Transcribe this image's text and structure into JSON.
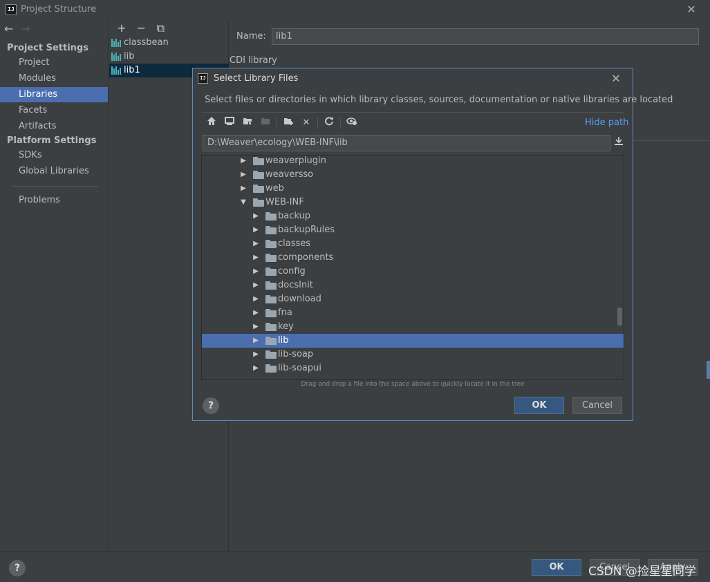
{
  "window": {
    "title": "Project Structure",
    "app_icon_text": "IJ"
  },
  "nav": {
    "back": "←",
    "forward": "→"
  },
  "sidebar": {
    "project_settings_header": "Project Settings",
    "project_settings_items": [
      "Project",
      "Modules",
      "Libraries",
      "Facets",
      "Artifacts"
    ],
    "platform_settings_header": "Platform Settings",
    "platform_settings_items": [
      "SDKs",
      "Global Libraries"
    ],
    "problems": "Problems",
    "selected": "Libraries"
  },
  "libraries": {
    "toolbar": {
      "add": "+",
      "remove": "−",
      "copy": "⧉"
    },
    "items": [
      "classbean",
      "lib",
      "lib1"
    ],
    "selected": "lib1",
    "icon_color": "#4fb0b9"
  },
  "detail": {
    "name_label": "Name:",
    "name_value": "lib1",
    "cdi_label": "CDI library"
  },
  "bottom": {
    "help": "?",
    "ok": "OK",
    "cancel": "Cancel",
    "apply": "Apply",
    "watermark": "CSDN @捡星星同学"
  },
  "dialog": {
    "title": "Select Library Files",
    "description": "Select files or directories in which library classes, sources, documentation or native libraries are located",
    "toolbar_icons": [
      "home-icon",
      "desktop-icon",
      "project-folder-icon",
      "module-folder-icon",
      "new-folder-icon",
      "delete-icon",
      "refresh-icon",
      "show-hidden-icon"
    ],
    "hide_path": "Hide path",
    "path": "D:\\Weaver\\ecology\\WEB-INF\\lib",
    "tree": {
      "rows": [
        {
          "label": "weaverplugin",
          "depth": 0,
          "expanded": false
        },
        {
          "label": "weaversso",
          "depth": 0,
          "expanded": false
        },
        {
          "label": "web",
          "depth": 0,
          "expanded": false
        },
        {
          "label": "WEB-INF",
          "depth": 0,
          "expanded": true
        },
        {
          "label": "backup",
          "depth": 1,
          "expanded": false
        },
        {
          "label": "backupRules",
          "depth": 1,
          "expanded": false
        },
        {
          "label": "classes",
          "depth": 1,
          "expanded": false
        },
        {
          "label": "components",
          "depth": 1,
          "expanded": false
        },
        {
          "label": "config",
          "depth": 1,
          "expanded": false
        },
        {
          "label": "docsInit",
          "depth": 1,
          "expanded": false
        },
        {
          "label": "download",
          "depth": 1,
          "expanded": false
        },
        {
          "label": "fna",
          "depth": 1,
          "expanded": false
        },
        {
          "label": "key",
          "depth": 1,
          "expanded": false
        },
        {
          "label": "lib",
          "depth": 1,
          "expanded": false,
          "selected": true
        },
        {
          "label": "lib-soap",
          "depth": 1,
          "expanded": false
        },
        {
          "label": "lib-soapui",
          "depth": 1,
          "expanded": false
        }
      ]
    },
    "drag_hint": "Drag and drop a file into the space above to quickly locate it in the tree",
    "help": "?",
    "ok": "OK",
    "cancel": "Cancel"
  },
  "colors": {
    "background": "#3c3f41",
    "selection": "#4b6eaf",
    "accent_link": "#589df6",
    "default_button": "#365880",
    "dialog_border": "#5d8dc1"
  }
}
